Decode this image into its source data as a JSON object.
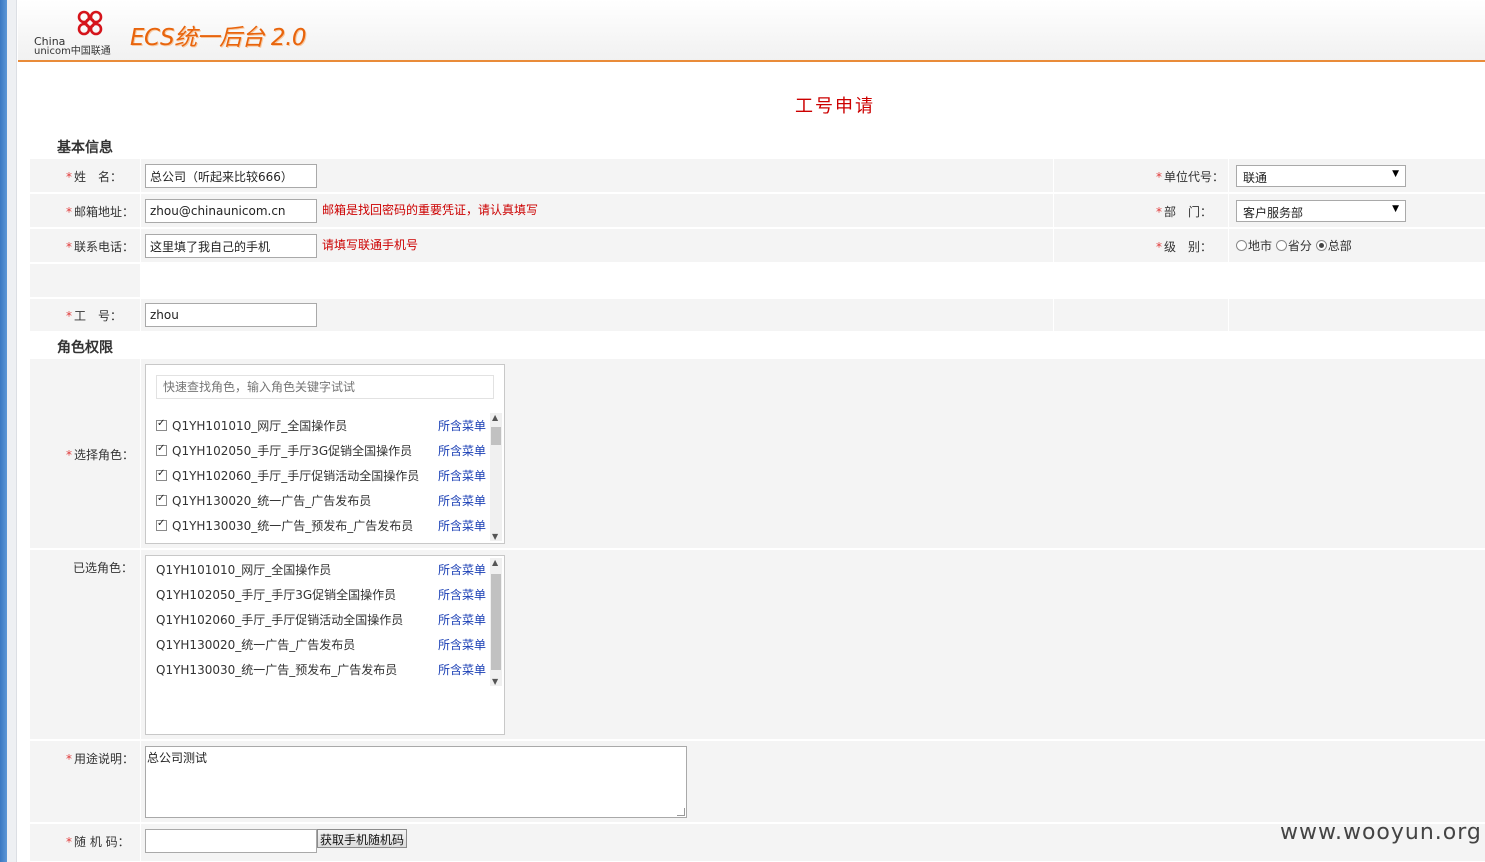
{
  "header": {
    "logo_en_1": "China",
    "logo_en_2": "unicom中国联通",
    "brand": "ECS统一后台 2.0"
  },
  "page_title": "工号申请",
  "sections": {
    "basic": "基本信息",
    "roles": "角色权限"
  },
  "form": {
    "name": {
      "label": "姓　名：",
      "value": "总公司（听起来比较666）"
    },
    "email": {
      "label": "邮箱地址：",
      "value": "zhou@chinaunicom.cn",
      "hint": "邮箱是找回密码的重要凭证，请认真填写"
    },
    "phone": {
      "label": "联系电话：",
      "value": "这里填了我自己的手机",
      "hint": "请填写联通手机号"
    },
    "unit_code": {
      "label": "单位代号：",
      "value": "联通"
    },
    "department": {
      "label": "部　门：",
      "value": "客户服务部"
    },
    "level": {
      "label": "级　别：",
      "options": [
        "地市",
        "省分",
        "总部"
      ],
      "selected": "总部"
    },
    "work_id": {
      "label": "工　号：",
      "value": "zhou"
    },
    "select_role": {
      "label": "选择角色：",
      "search_placeholder": "快速查找角色，输入角色关键字试试",
      "items": [
        {
          "name": "Q1YH101010_网厅_全国操作员",
          "link": "所含菜单",
          "checked": true
        },
        {
          "name": "Q1YH102050_手厅_手厅3G促销全国操作员",
          "link": "所含菜单",
          "checked": true
        },
        {
          "name": "Q1YH102060_手厅_手厅促销活动全国操作员",
          "link": "所含菜单",
          "checked": true
        },
        {
          "name": "Q1YH130020_统一广告_广告发布员",
          "link": "所含菜单",
          "checked": true
        },
        {
          "name": "Q1YH130030_统一广告_预发布_广告发布员",
          "link": "所含菜单",
          "checked": true
        }
      ]
    },
    "selected_role": {
      "label": "已选角色：",
      "items": [
        {
          "name": "Q1YH101010_网厅_全国操作员",
          "link": "所含菜单"
        },
        {
          "name": "Q1YH102050_手厅_手厅3G促销全国操作员",
          "link": "所含菜单"
        },
        {
          "name": "Q1YH102060_手厅_手厅促销活动全国操作员",
          "link": "所含菜单"
        },
        {
          "name": "Q1YH130020_统一广告_广告发布员",
          "link": "所含菜单"
        },
        {
          "name": "Q1YH130030_统一广告_预发布_广告发布员",
          "link": "所含菜单"
        }
      ]
    },
    "purpose": {
      "label": "用途说明：",
      "value": "总公司测试"
    },
    "random_code": {
      "label": "随 机 码：",
      "value": "",
      "button": "获取手机随机码"
    }
  },
  "watermark": "www.wooyun.org",
  "colors": {
    "accent_orange": "#e98b39",
    "title_red": "#cc0000",
    "link_blue": "#1a3fb5"
  }
}
